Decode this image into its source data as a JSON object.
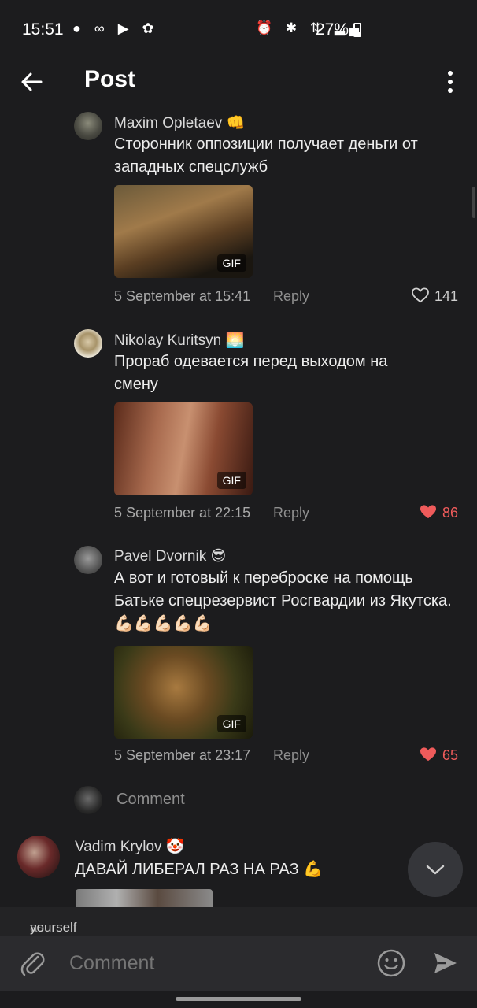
{
  "status": {
    "time": "15:51",
    "battery": "27%",
    "network": "4G"
  },
  "header": {
    "title": "Post"
  },
  "comments": [
    {
      "author": "Maxim Opletaev",
      "emoji": "👊",
      "text": "Сторонник оппозиции получает деньги от западных спецслужб",
      "media_badge": "GIF",
      "date": "5 September at 15:41",
      "reply": "Reply",
      "likes": "141",
      "liked": false
    },
    {
      "author": "Nikolay Kuritsyn",
      "emoji": "🌅",
      "text": "Прораб одевается перед выходом на смену",
      "media_badge": "GIF",
      "date": "5 September at 22:15",
      "reply": "Reply",
      "likes": "86",
      "liked": true
    },
    {
      "author": "Pavel Dvornik",
      "emoji": "😎",
      "text": "А вот и готовый к переброске на помощь Батьке спецрезервист Росгвардии из Якутска. 💪🏻💪🏻💪🏻💪🏻💪🏻",
      "media_badge": "GIF",
      "date": "5 September at 23:17",
      "reply": "Reply",
      "likes": "65",
      "liked": true
    }
  ],
  "inline_comment": {
    "placeholder": "Comment"
  },
  "next_comment": {
    "author": "Vadim Krylov",
    "emoji": "🤡",
    "text": "ДАВАЙ ЛИБЕРАЛ РАЗ НА РАЗ 💪"
  },
  "as_bar": {
    "prefix": "as",
    "identity": "yourself"
  },
  "composer": {
    "placeholder": "Comment"
  },
  "colors": {
    "background": "#1c1c1e",
    "like_red": "#ef5b5b"
  }
}
